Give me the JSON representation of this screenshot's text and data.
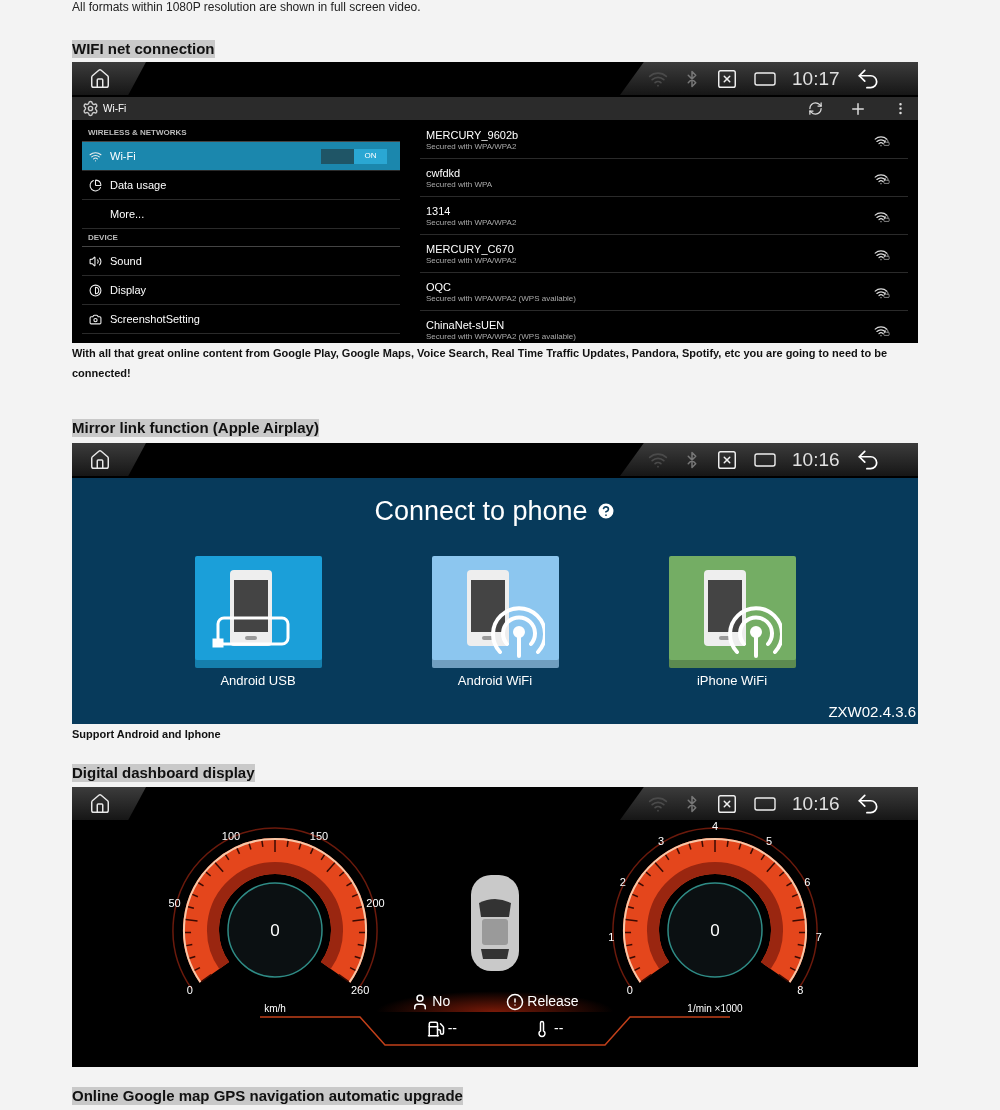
{
  "intro_text": "All formats within 1080P resolution are shown in full screen video.",
  "wifi_section": {
    "heading": "WIFI net connection",
    "status_bar": {
      "time": "10:17"
    },
    "action_bar": {
      "title": "Wi-Fi"
    },
    "settings": [
      {
        "kind": "header",
        "label": "WIRELESS & NETWORKS"
      },
      {
        "kind": "item",
        "label": "Wi-Fi",
        "selected": true,
        "toggle": {
          "on": true,
          "label": "ON"
        }
      },
      {
        "kind": "item",
        "label": "Data usage",
        "selected": false
      },
      {
        "kind": "item",
        "label": "More...",
        "selected": false
      },
      {
        "kind": "header",
        "label": "DEVICE"
      },
      {
        "kind": "item",
        "label": "Sound",
        "selected": false
      },
      {
        "kind": "item",
        "label": "Display",
        "selected": false
      },
      {
        "kind": "item",
        "label": "ScreenshotSetting",
        "selected": false
      }
    ],
    "networks": [
      {
        "name": "MERCURY_9602b",
        "security": "Secured with WPA/WPA2"
      },
      {
        "name": "cwfdkd",
        "security": "Secured with WPA"
      },
      {
        "name": "1314",
        "security": "Secured with WPA/WPA2"
      },
      {
        "name": "MERCURY_C670",
        "security": "Secured with WPA/WPA2"
      },
      {
        "name": "OQC",
        "security": "Secured with WPA/WPA2 (WPS available)"
      },
      {
        "name": "ChinaNet-sUEN",
        "security": "Secured with WPA/WPA2 (WPS available)"
      }
    ],
    "caption": "With all that great online content from Google Play, Google Maps, Voice Search, Real Time Traffic Updates, Pandora, Spotify, etc you are going to need to be connected!"
  },
  "mirror_section": {
    "heading": "Mirror link function (Apple Airplay)",
    "status_bar": {
      "time": "10:16"
    },
    "title": "Connect to phone",
    "options": [
      {
        "kind": "usb",
        "label": "Android USB",
        "color": "#1b9fd9"
      },
      {
        "kind": "wifi",
        "label": "Android WiFi",
        "color": "#8cc6ef"
      },
      {
        "kind": "iphone",
        "label": "iPhone WiFi",
        "color": "#74ad64"
      }
    ],
    "version": "ZXW02.4.3.6",
    "caption": "Support Android and Iphone"
  },
  "dashboard_section": {
    "heading": "Digital dashboard display",
    "status_bar": {
      "time": "10:16"
    },
    "speedometer": {
      "ticks": [
        "0",
        "50",
        "100",
        "150",
        "200",
        "260"
      ],
      "reading": "0",
      "unit": "km/h"
    },
    "tachometer": {
      "ticks": [
        "0",
        "1",
        "2",
        "3",
        "4",
        "5",
        "6",
        "7",
        "8"
      ],
      "reading": "0",
      "unit": "1/min ×1000"
    },
    "indicators": [
      {
        "kind": "seatbelt",
        "label": "No"
      },
      {
        "kind": "brake",
        "label": "Release"
      },
      {
        "kind": "fuel",
        "label": "--"
      },
      {
        "kind": "temperature",
        "label": "--"
      }
    ]
  },
  "next_heading": "Online Google map GPS navigation automatic upgrade"
}
